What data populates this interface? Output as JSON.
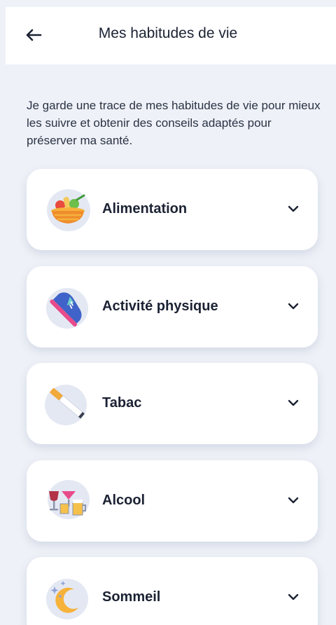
{
  "header": {
    "title": "Mes habitudes de vie",
    "back_icon": "arrow-left-icon"
  },
  "intro": "Je garde une trace de mes habitudes de vie pour mieux les suivre et obtenir des conseils adaptés pour préserver ma santé.",
  "categories": [
    {
      "label": "Alimentation",
      "icon": "food-basket-icon"
    },
    {
      "label": "Activité physique",
      "icon": "sneaker-icon"
    },
    {
      "label": "Tabac",
      "icon": "cigarette-icon"
    },
    {
      "label": "Alcool",
      "icon": "drinks-icon"
    },
    {
      "label": "Sommeil",
      "icon": "moon-icon"
    }
  ],
  "colors": {
    "background": "#eef1f7",
    "card": "#ffffff",
    "icon_blob": "#e4e8f3",
    "text": "#1b2233"
  }
}
